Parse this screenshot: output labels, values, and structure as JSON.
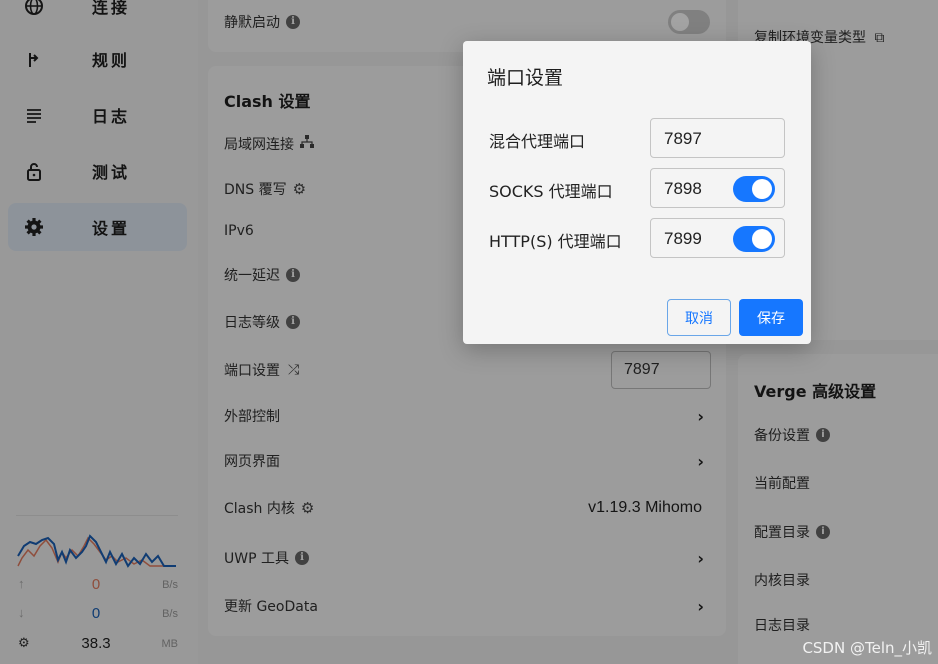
{
  "sidebar": {
    "items": [
      {
        "label": "连接",
        "icon": "globe-icon"
      },
      {
        "label": "规则",
        "icon": "route-icon"
      },
      {
        "label": "日志",
        "icon": "list-icon"
      },
      {
        "label": "测试",
        "icon": "lock-icon"
      },
      {
        "label": "设置",
        "icon": "gear-icon",
        "active": true
      }
    ],
    "traffic": {
      "upload": {
        "value": "0",
        "unit": "B/s",
        "color": "#e07a5f"
      },
      "download": {
        "value": "0",
        "unit": "B/s",
        "color": "#1a5fb4"
      },
      "memory": {
        "value": "38.3",
        "unit": "MB"
      }
    }
  },
  "main": {
    "top_card": {
      "silent_start_label": "静默启动"
    },
    "clash_card": {
      "title": "Clash 设置",
      "rows": {
        "lan": "局域网连接",
        "dns": "DNS 覆写",
        "ipv6": "IPv6",
        "unified_delay": "统一延迟",
        "log_level": "日志等级",
        "port_settings": "端口设置",
        "port_value": "7897",
        "external_control": "外部控制",
        "web_ui": "网页界面",
        "clash_core": "Clash 内核",
        "clash_core_version": "v1.19.3 Mihomo",
        "uwp_tool": "UWP 工具",
        "update_geodata": "更新 GeoData"
      }
    },
    "right_top_card": {
      "copy_env_label": "复制环境变量类型"
    },
    "verge_card": {
      "title": "Verge 高级设置",
      "rows": {
        "backup": "备份设置",
        "current_config": "当前配置",
        "config_dir": "配置目录",
        "core_dir": "内核目录",
        "log_dir": "日志目录"
      }
    }
  },
  "dialog": {
    "title": "端口设置",
    "fields": [
      {
        "label": "混合代理端口",
        "value": "7897"
      },
      {
        "label": "SOCKS 代理端口",
        "value": "7898",
        "enabled": true
      },
      {
        "label": "HTTP(S) 代理端口",
        "value": "7899",
        "enabled": true
      }
    ],
    "cancel_label": "取消",
    "save_label": "保存"
  },
  "colors": {
    "accent": "#1677ff"
  },
  "watermark": "CSDN @Teln_小凯"
}
